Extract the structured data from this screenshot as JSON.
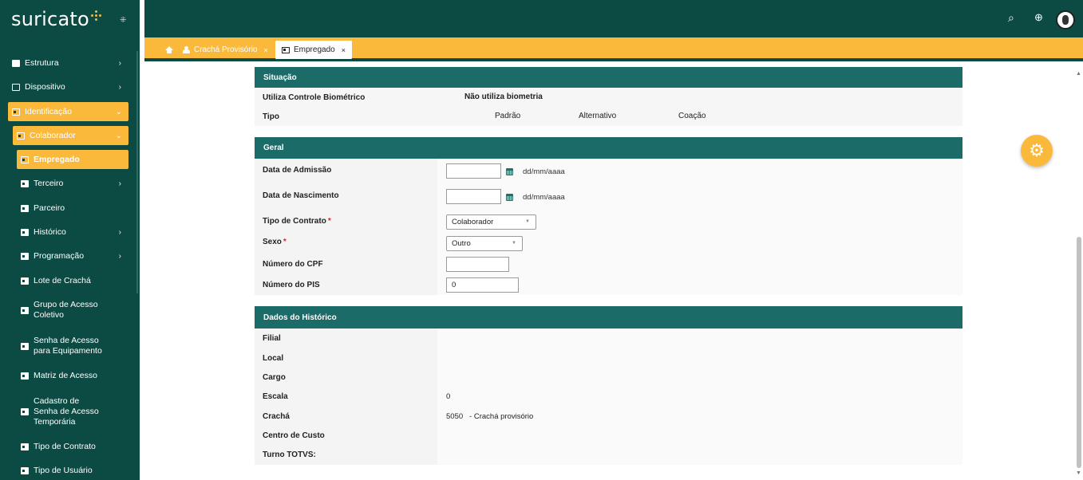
{
  "app": {
    "logo_text": "suricato"
  },
  "topbar": {
    "search_icon": "search-icon",
    "language_icon": "globe-icon",
    "avatar_icon": "user-avatar"
  },
  "tabs": [
    {
      "label": "Crachá Provisório",
      "close": "×",
      "icon": "person-badge-icon"
    },
    {
      "label": "Empregado",
      "close": "×",
      "icon": "id-card-icon"
    }
  ],
  "sidebar": {
    "items": [
      {
        "label": "Estrutura",
        "chevron": "›"
      },
      {
        "label": "Dispositivo",
        "chevron": "›"
      },
      {
        "label": "Identificação",
        "chevron": "⌄"
      },
      {
        "label": "Colaborador",
        "chevron": "⌄"
      },
      {
        "label": "Empregado"
      },
      {
        "label": "Terceiro",
        "chevron": "›"
      },
      {
        "label": "Parceiro"
      },
      {
        "label": "Histórico",
        "chevron": "›"
      },
      {
        "label": "Programação",
        "chevron": "›"
      },
      {
        "label": "Lote de Crachá"
      },
      {
        "label": "Grupo de Acesso Coletivo"
      },
      {
        "label": "Senha de Acesso para Equipamento"
      },
      {
        "label": "Matriz de Acesso"
      },
      {
        "label": "Cadastro de Senha de Acesso Temporária"
      },
      {
        "label": "Tipo de Contrato"
      },
      {
        "label": "Tipo de Usuário"
      }
    ]
  },
  "situacao": {
    "title": "Situação",
    "biometric_label": "Utiliza Controle Biométrico",
    "biometric_value": "Não utiliza biometria",
    "tipo_label": "Tipo",
    "tipo_options": [
      "Padrão",
      "Alternativo",
      "Coação"
    ]
  },
  "geral": {
    "title": "Geral",
    "admissao_label": "Data de Admissão",
    "admissao_value": "",
    "admissao_format": "dd/mm/aaaa",
    "nascimento_label": "Data de Nascimento",
    "nascimento_value": "",
    "nascimento_format": "dd/mm/aaaa",
    "contrato_label": "Tipo de Contrato",
    "contrato_value": "Colaborador",
    "sexo_label": "Sexo",
    "sexo_value": "Outro",
    "required_mark": "*",
    "cpf_label": "Número do CPF",
    "cpf_value": "",
    "pis_label": "Número do PIS",
    "pis_value": "0"
  },
  "historico": {
    "title": "Dados do Histórico",
    "filial_label": "Filial",
    "local_label": "Local",
    "cargo_label": "Cargo",
    "escala_label": "Escala",
    "escala_value": "0",
    "cracha_label": "Crachá",
    "cracha_value": "5050   - Crachá provisório",
    "centro_label": "Centro de Custo",
    "turno_label": "Turno TOTVS:"
  },
  "colors": {
    "primary": "#0c4b44",
    "section": "#1b6b68",
    "accent": "#fbb93b"
  }
}
